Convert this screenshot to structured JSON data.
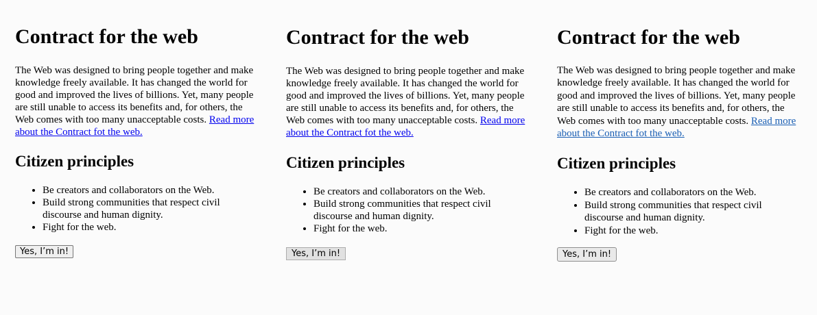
{
  "panels": [
    {
      "title": "Contract for the web",
      "intro_text": "The Web was designed to bring people together and make knowledge freely available. It has changed the world for good and improved the lives of billions. Yet, many people are still unable to access its benefits and, for others, the Web comes with too many unacceptable costs. ",
      "link_text": "Read more about the Contract fot the web.",
      "subtitle": "Citizen principles",
      "principles": [
        "Be creators and collaborators on the Web.",
        "Build strong communities that respect civil discourse and human dignity.",
        "Fight for the web."
      ],
      "button_label": "Yes, I’m in!"
    },
    {
      "title": "Contract for the web",
      "intro_text": "The Web was designed to bring people together and make knowledge freely available. It has changed the world for good and improved the lives of billions. Yet, many people are still unable to access its benefits and, for others, the Web comes with too many unacceptable costs. ",
      "link_text": "Read more about the Contract fot the web.",
      "subtitle": "Citizen principles",
      "principles": [
        "Be creators and collaborators on the Web.",
        "Build strong communities that respect civil discourse and human dignity.",
        "Fight for the web."
      ],
      "button_label": "Yes, I’m in!"
    },
    {
      "title": "Contract for the web",
      "intro_text": "The Web was designed to bring people together and make knowledge freely available. It has changed the world for good and improved the lives of billions. Yet, many people are still unable to access its benefits and, for others, the Web comes with too many unacceptable costs. ",
      "link_text": "Read more about the Contract fot the web.",
      "subtitle": "Citizen principles",
      "principles": [
        "Be creators and collaborators on the Web.",
        "Build strong communities that respect civil discourse and human dignity.",
        "Fight for the web."
      ],
      "button_label": "Yes, I’m in!"
    }
  ]
}
